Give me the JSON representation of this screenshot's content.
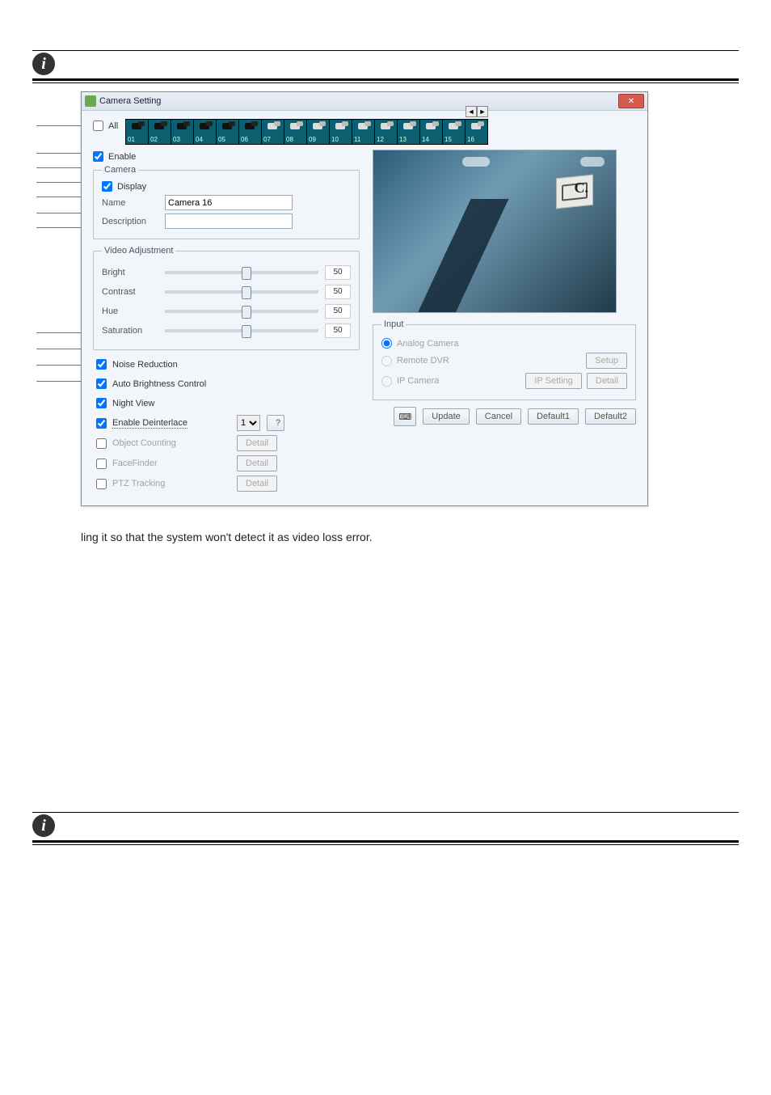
{
  "window": {
    "title": "Camera Setting",
    "close_glyph": "✕"
  },
  "all": {
    "label": "All",
    "checked": false
  },
  "scroll": {
    "left_glyph": "◄",
    "right_glyph": "►"
  },
  "cameras": [
    {
      "num": "01",
      "icon": "black"
    },
    {
      "num": "02",
      "icon": "black"
    },
    {
      "num": "03",
      "icon": "black"
    },
    {
      "num": "04",
      "icon": "black"
    },
    {
      "num": "05",
      "icon": "black"
    },
    {
      "num": "06",
      "icon": "black"
    },
    {
      "num": "07",
      "icon": "white"
    },
    {
      "num": "08",
      "icon": "white"
    },
    {
      "num": "09",
      "icon": "white"
    },
    {
      "num": "10",
      "icon": "white"
    },
    {
      "num": "11",
      "icon": "white"
    },
    {
      "num": "12",
      "icon": "white"
    },
    {
      "num": "13",
      "icon": "white"
    },
    {
      "num": "14",
      "icon": "white"
    },
    {
      "num": "15",
      "icon": "white"
    },
    {
      "num": "16",
      "icon": "white"
    }
  ],
  "enable": {
    "label": "Enable",
    "checked": true
  },
  "camera_group": {
    "legend": "Camera",
    "display": {
      "label": "Display",
      "checked": true
    },
    "name": {
      "label": "Name",
      "value": "Camera 16"
    },
    "description": {
      "label": "Description",
      "value": ""
    }
  },
  "video_adj": {
    "legend": "Video Adjustment",
    "rows": [
      {
        "key": "bright",
        "label": "Bright",
        "value": 50
      },
      {
        "key": "contrast",
        "label": "Contrast",
        "value": 50
      },
      {
        "key": "hue",
        "label": "Hue",
        "value": 50
      },
      {
        "key": "saturation",
        "label": "Saturation",
        "value": 50
      }
    ]
  },
  "options": {
    "noise_reduction": {
      "label": "Noise Reduction",
      "checked": true
    },
    "auto_brightness": {
      "label": "Auto Brightness Control",
      "checked": true
    },
    "night_view": {
      "label": "Night View",
      "checked": true
    },
    "enable_deinterlace": {
      "label": "Enable Deinterlace",
      "checked": true,
      "select_value": "1",
      "help_glyph": "?"
    },
    "object_counting": {
      "label": "Object Counting",
      "checked": false,
      "button": "Detail"
    },
    "facefinder": {
      "label": "FaceFinder",
      "checked": false,
      "button": "Detail"
    },
    "ptz_tracking": {
      "label": "PTZ Tracking",
      "checked": false,
      "button": "Detail"
    }
  },
  "input": {
    "legend": "Input",
    "analog": {
      "label": "Analog Camera",
      "selected": true
    },
    "remote": {
      "label": "Remote DVR",
      "setup_label": "Setup"
    },
    "ip": {
      "label": "IP Camera",
      "ip_setting_label": "IP Setting",
      "detail_label": "Detail"
    }
  },
  "bottom": {
    "keyboard_glyph": "⌨",
    "update": "Update",
    "cancel": "Cancel",
    "default1": "Default1",
    "default2": "Default2"
  },
  "preview": {
    "c_label": "C."
  },
  "body_text": "ling it so that the system won't detect it as video loss error."
}
